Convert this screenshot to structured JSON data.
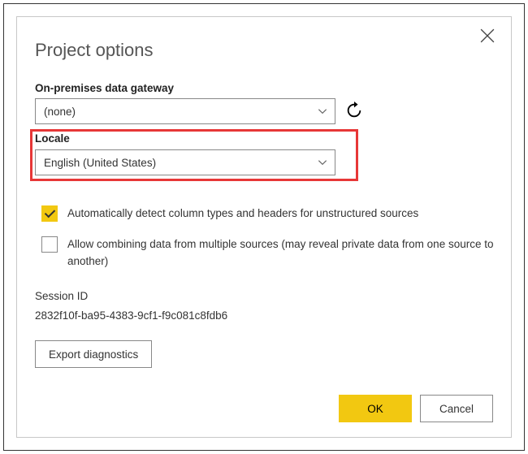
{
  "dialog": {
    "title": "Project options",
    "gateway": {
      "label": "On-premises data gateway",
      "value": "(none)"
    },
    "locale": {
      "label": "Locale",
      "value": "English (United States)"
    },
    "options": {
      "autoDetect": "Automatically detect column types and headers for unstructured sources",
      "allowCombine": "Allow combining data from multiple sources (may reveal private data from one source to another)"
    },
    "session": {
      "label": "Session ID",
      "value": "2832f10f-ba95-4383-9cf1-f9c081c8fdb6"
    },
    "buttons": {
      "export": "Export diagnostics",
      "ok": "OK",
      "cancel": "Cancel"
    }
  }
}
